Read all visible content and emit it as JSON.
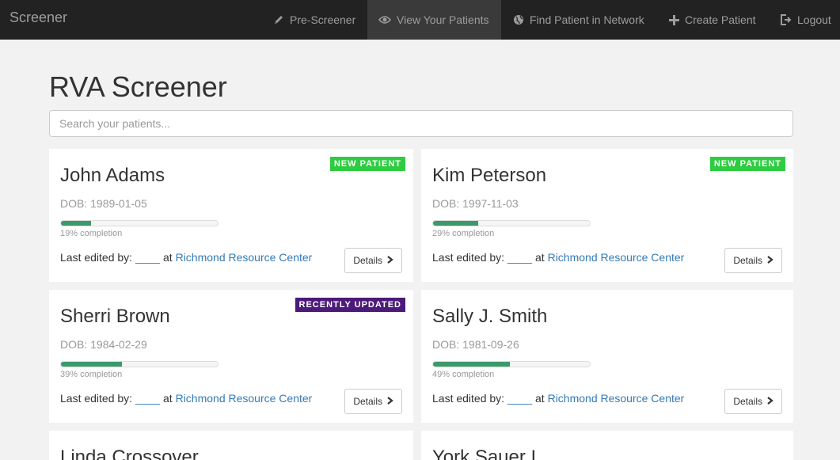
{
  "navbar": {
    "brand": "Screener",
    "items": [
      {
        "label": "Pre-Screener",
        "icon": "pencil-icon"
      },
      {
        "label": "View Your Patients",
        "icon": "eye-icon",
        "active": true
      },
      {
        "label": "Find Patient in Network",
        "icon": "globe-icon"
      },
      {
        "label": "Create Patient",
        "icon": "plus-icon"
      },
      {
        "label": "Logout",
        "icon": "logout-icon"
      }
    ]
  },
  "main": {
    "title": "RVA Screener",
    "search_placeholder": "Search your patients..."
  },
  "patients": [
    {
      "name": "John Adams",
      "dob": "DOB: 1989-01-05",
      "progress": 19,
      "completion": "19% completion",
      "badge": "NEW PATIENT",
      "edited_label": "Last edited by:",
      "editor": "____",
      "at": "at",
      "location": "Richmond Resource Center",
      "details": "Details"
    },
    {
      "name": "Kim Peterson",
      "dob": "DOB: 1997-11-03",
      "progress": 29,
      "completion": "29% completion",
      "badge": "NEW PATIENT",
      "edited_label": "Last edited by:",
      "editor": "____",
      "at": "at",
      "location": "Richmond Resource Center",
      "details": "Details"
    },
    {
      "name": "Sherri Brown",
      "dob": "DOB: 1984-02-29",
      "progress": 39,
      "completion": "39% completion",
      "badge": "RECENTLY UPDATED",
      "edited_label": "Last edited by:",
      "editor": "____",
      "at": "at",
      "location": "Richmond Resource Center",
      "details": "Details"
    },
    {
      "name": "Sally J. Smith",
      "dob": "DOB: 1981-09-26",
      "progress": 49,
      "completion": "49% completion",
      "badge": "",
      "edited_label": "Last edited by:",
      "editor": "____",
      "at": "at",
      "location": "Richmond Resource Center",
      "details": "Details"
    },
    {
      "name": "Linda Crossover",
      "dob": "",
      "progress": null,
      "completion": "",
      "badge": "",
      "edited_label": "",
      "editor": "",
      "at": "",
      "location": "",
      "details": ""
    },
    {
      "name": "York Sauer I",
      "dob": "",
      "progress": null,
      "completion": "",
      "badge": "",
      "edited_label": "",
      "editor": "",
      "at": "",
      "location": "",
      "details": ""
    }
  ],
  "colors": {
    "navbar_bg": "#222222",
    "nav_active_bg": "#3a3a3a",
    "badge_new": "#2ecc40",
    "badge_updated": "#4b1a7a",
    "progress_fill": "#3a9a6a",
    "link": "#337ab7"
  }
}
